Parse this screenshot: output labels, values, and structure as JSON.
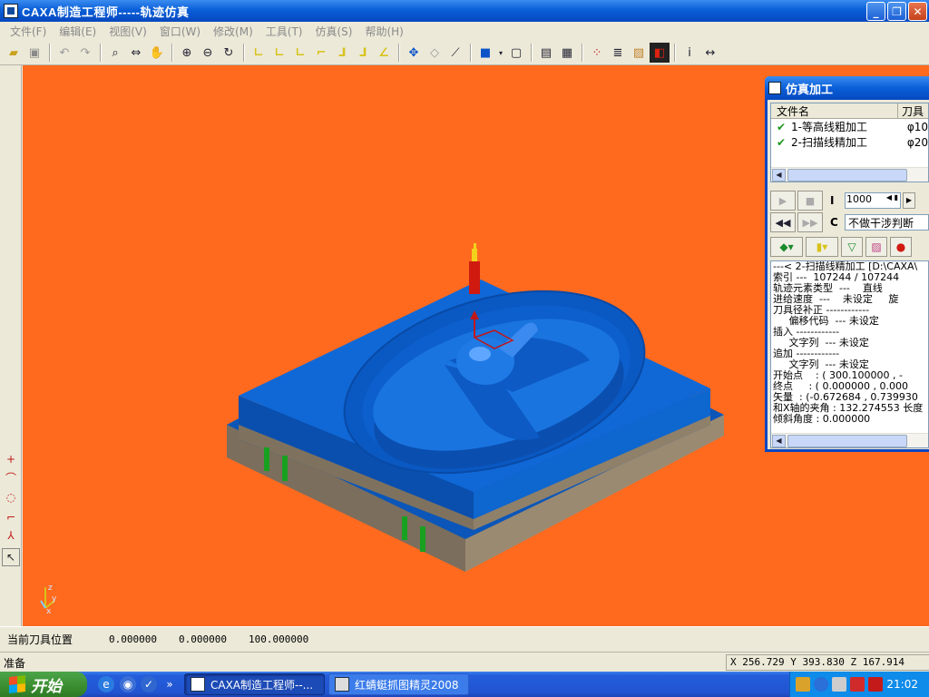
{
  "window": {
    "title": "CAXA制造工程师-----轨迹仿真",
    "minimize": "_",
    "restore": "❐",
    "close": "✕"
  },
  "menu": [
    "文件(F)",
    "编辑(E)",
    "视图(V)",
    "窗口(W)",
    "修改(M)",
    "工具(T)",
    "仿真(S)",
    "帮助(H)"
  ],
  "coords_bar": {
    "label": "当前刀具位置",
    "x": "0.000000",
    "y": "0.000000",
    "z": "100.000000"
  },
  "status": {
    "text": "准备",
    "coords": "X  256.729 Y  393.830 Z  167.914"
  },
  "taskbar": {
    "start": "开始",
    "quick_more": "»",
    "tasks": [
      {
        "label": "CAXA制造工程师--..."
      },
      {
        "label": "红蜻蜓抓图精灵2008"
      }
    ],
    "clock": "21:02"
  },
  "sim_panel": {
    "title": "仿真加工",
    "col_file": "文件名",
    "col_tool": "刀具",
    "files": [
      {
        "name": "1-等高线粗加工",
        "tool": "φ10"
      },
      {
        "name": "2-扫描线精加工",
        "tool": "φ20"
      }
    ],
    "label_i": "I",
    "label_c": "C",
    "speed": "1000",
    "interference": "不做干涉判断",
    "info_lines": [
      "---< 2-扫描线精加工 [D:\\CAXA\\",
      "索引 ---  107244 / 107244",
      "轨迹元素类型  ---    直线",
      "进给速度  ---    未设定     旋",
      "刀具径补正 ------------",
      "     偏移代码  --- 未设定",
      "插入 ------------",
      "     文字列  --- 未设定",
      "追加 ------------",
      "     文字列  --- 未设定",
      "开始点    : ( 300.100000 , -",
      "终点     : ( 0.000000 , 0.000",
      "矢量  : (-0.672684 , 0.739930",
      "和X轴的夹角 : 132.274553 长度",
      "倾斜角度 : 0.000000"
    ]
  },
  "colors": {
    "viewport_bg": "#ff6a1f",
    "part_top": "#0a5ec4",
    "part_side": "#8f8069",
    "tool_red": "#d01a10",
    "tool_yellow": "#f2d21c"
  }
}
